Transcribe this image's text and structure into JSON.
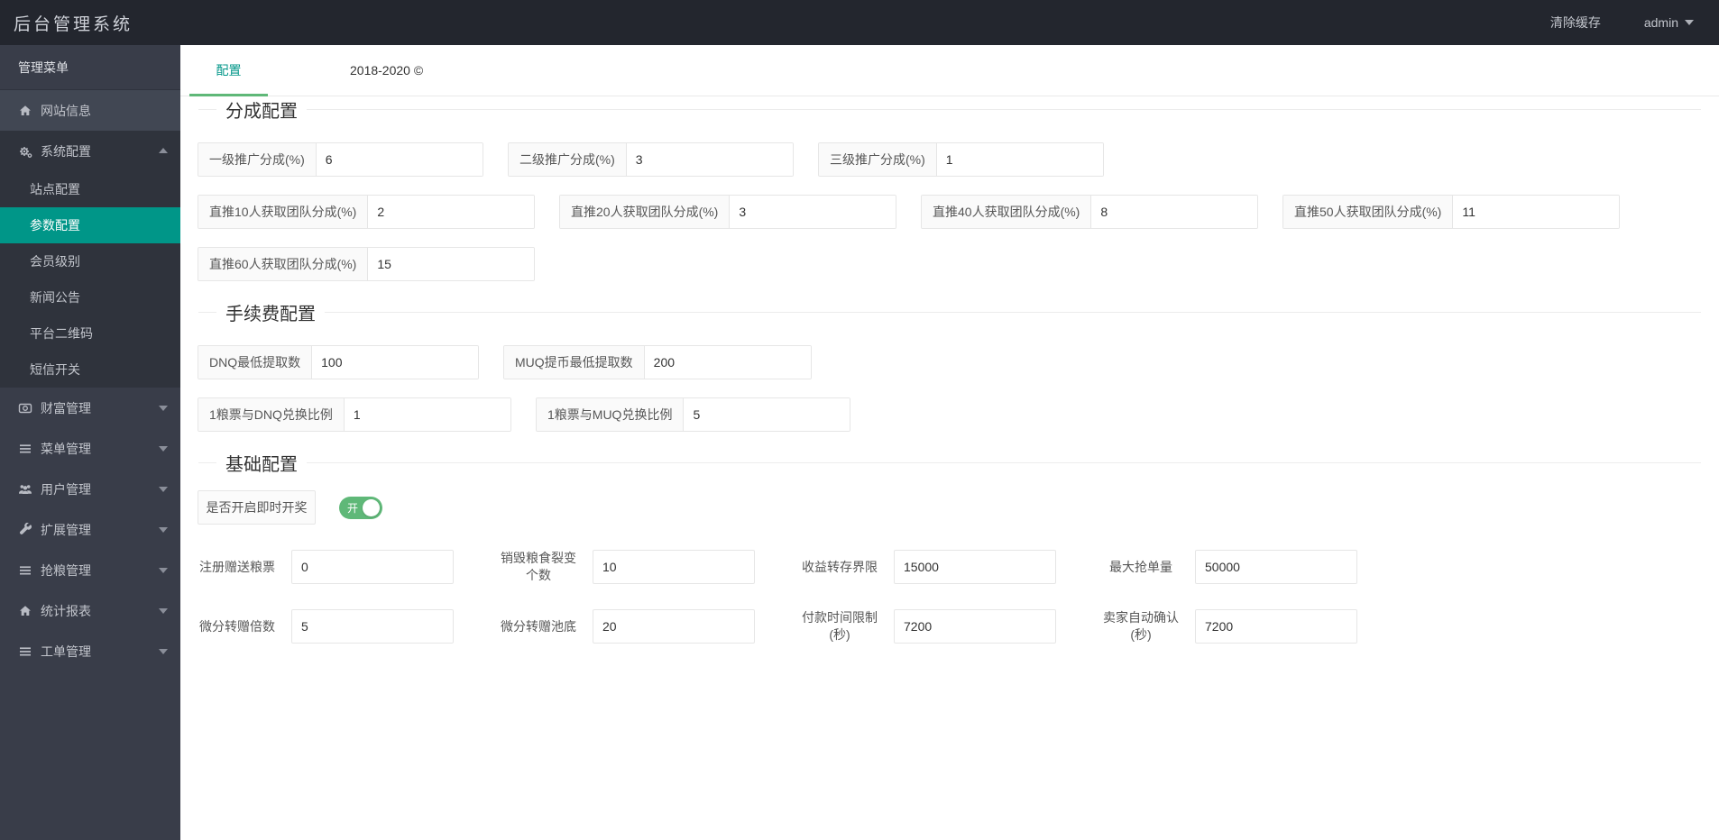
{
  "colors": {
    "sidebar_active": "#009688",
    "tab_green": "#5fb878",
    "toggle_on": "#5fb878",
    "header_bg": "#23262e",
    "sidebar_bg": "#393d49"
  },
  "header": {
    "title": "后台管理系统",
    "clear_cache": "清除缓存",
    "username": "admin"
  },
  "sidebar": {
    "title": "管理菜单",
    "items": [
      {
        "label": "网站信息",
        "icon": "home-icon"
      },
      {
        "label": "系统配置",
        "icon": "gears-icon",
        "expanded": true
      },
      {
        "label": "财富管理",
        "icon": "banknote-icon"
      },
      {
        "label": "菜单管理",
        "icon": "menu-bars-icon"
      },
      {
        "label": "用户管理",
        "icon": "users-icon"
      },
      {
        "label": "扩展管理",
        "icon": "wrench-icon"
      },
      {
        "label": "抢粮管理",
        "icon": "menu-bars-icon"
      },
      {
        "label": "统计报表",
        "icon": "home-icon"
      },
      {
        "label": "工单管理",
        "icon": "menu-bars-icon"
      }
    ],
    "system_children": [
      {
        "label": "站点配置",
        "active": false
      },
      {
        "label": "参数配置",
        "active": true
      },
      {
        "label": "会员级别",
        "active": false
      },
      {
        "label": "新闻公告",
        "active": false
      },
      {
        "label": "平台二维码",
        "active": false
      },
      {
        "label": "短信开关",
        "active": false
      }
    ]
  },
  "tabbar": {
    "active_tab": "配置",
    "copyright": "2018-2020 ©"
  },
  "sections": {
    "commission": {
      "title": "分成配置",
      "row1": [
        {
          "label": "一级推广分成(%)",
          "value": "6"
        },
        {
          "label": "二级推广分成(%)",
          "value": "3"
        },
        {
          "label": "三级推广分成(%)",
          "value": "1"
        }
      ],
      "row2": [
        {
          "label": "直推10人获取团队分成(%)",
          "value": "2"
        },
        {
          "label": "直推20人获取团队分成(%)",
          "value": "3"
        },
        {
          "label": "直推40人获取团队分成(%)",
          "value": "8"
        },
        {
          "label": "直推50人获取团队分成(%)",
          "value": "11"
        }
      ],
      "row3": [
        {
          "label": "直推60人获取团队分成(%)",
          "value": "15"
        }
      ]
    },
    "fee": {
      "title": "手续费配置",
      "row1": [
        {
          "label": "DNQ最低提取数",
          "value": "100"
        },
        {
          "label": "MUQ提币最低提取数",
          "value": "200"
        }
      ],
      "row2": [
        {
          "label": "1粮票与DNQ兑换比例",
          "value": "1"
        },
        {
          "label": "1粮票与MUQ兑换比例",
          "value": "5"
        }
      ]
    },
    "basic": {
      "title": "基础配置",
      "toggle_label": "是否开启即时开奖",
      "toggle_on": "开",
      "row1": [
        {
          "label": "注册赠送粮票",
          "value": "0"
        },
        {
          "label": "销毁粮食裂变个数",
          "value": "10"
        },
        {
          "label": "收益转存界限",
          "value": "15000"
        },
        {
          "label": "最大抢单量",
          "value": "50000"
        }
      ],
      "row2": [
        {
          "label": "微分转赠倍数",
          "value": "5"
        },
        {
          "label": "微分转赠池底",
          "value": "20"
        },
        {
          "label": "付款时间限制(秒)",
          "value": "7200"
        },
        {
          "label": "卖家自动确认(秒)",
          "value": "7200"
        }
      ]
    }
  }
}
